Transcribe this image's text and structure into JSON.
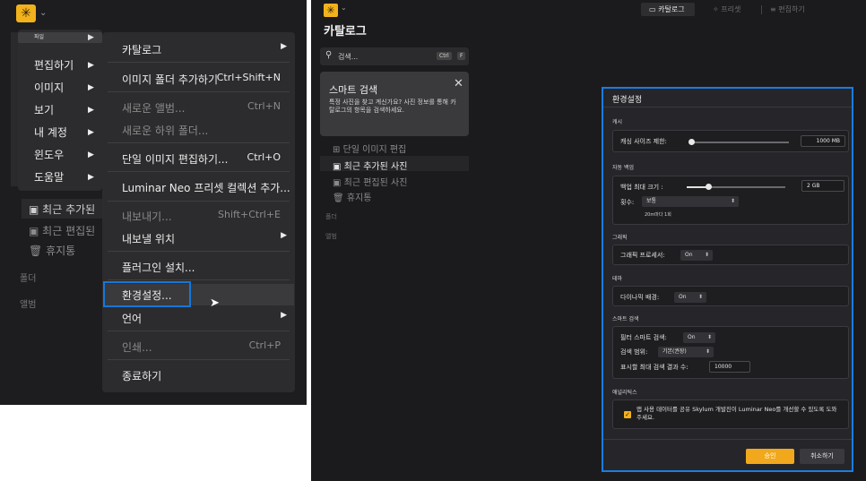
{
  "left": {
    "menu_main": [
      {
        "label": "파일",
        "selected": true
      },
      {
        "label": "편집하기"
      },
      {
        "label": "이미지"
      },
      {
        "label": "보기"
      },
      {
        "label": "내 계정"
      },
      {
        "label": "윈도우"
      },
      {
        "label": "도움말"
      }
    ],
    "menu_file": [
      {
        "label": "카탈로그",
        "shortcut": "",
        "submenu": true,
        "disabled": false
      },
      {
        "label": "이미지 폴더 추가하기",
        "shortcut": "Ctrl+Shift+N",
        "submenu": false,
        "disabled": false
      },
      {
        "label": "새로운 앨범...",
        "shortcut": "Ctrl+N",
        "submenu": false,
        "disabled": true
      },
      {
        "label": "새로운 하위 폴더...",
        "shortcut": "",
        "submenu": false,
        "disabled": true
      },
      {
        "label": "단일 이미지 편집하기...",
        "shortcut": "Ctrl+O",
        "submenu": false,
        "disabled": false
      },
      {
        "label": "Luminar Neo 프리셋 컬렉션 추가...",
        "shortcut": "",
        "submenu": false,
        "disabled": false
      },
      {
        "label": "내보내기...",
        "shortcut": "Shift+Ctrl+E",
        "submenu": false,
        "disabled": true
      },
      {
        "label": "내보낼 위치",
        "shortcut": "",
        "submenu": true,
        "disabled": false
      },
      {
        "label": "플러그인 설치...",
        "shortcut": "",
        "submenu": false,
        "disabled": false
      },
      {
        "label": "환경설정...",
        "shortcut": "",
        "submenu": false,
        "disabled": false
      },
      {
        "label": "언어",
        "shortcut": "",
        "submenu": true,
        "disabled": false
      },
      {
        "label": "인쇄...",
        "shortcut": "Ctrl+P",
        "submenu": false,
        "disabled": true
      },
      {
        "label": "종료하기",
        "shortcut": "",
        "submenu": false,
        "disabled": false
      }
    ],
    "sidebar": {
      "recent_added": "최근 추가된",
      "recent_edited": "최근 편집된",
      "trash": "휴지통",
      "folders": "폴더",
      "albums": "앨범"
    }
  },
  "right": {
    "toolbar": {
      "catalog": "카탈로그",
      "presets": "프리셋",
      "edit": "편집하기"
    },
    "title": "카탈로그",
    "search": {
      "placeholder": "검색...",
      "kbd1": "Ctrl",
      "kbd2": "F"
    },
    "smart_search": {
      "title": "스마트 검색",
      "desc": "특정 사진을 찾고 계신가요? 사진 정보를 통해 카탈로그의 항목을 검색하세요."
    },
    "nav": {
      "single_edit": "단일 이미지 편집",
      "recent_added": "최근 추가된 사진",
      "recent_edited": "최근 편집된 사진",
      "trash": "휴지통",
      "folders": "폴더",
      "albums": "앨범"
    },
    "dialog": {
      "title": "환경설정",
      "cache": {
        "heading": "캐시",
        "label": "캐싱 사이즈 제한:",
        "value": "1000 MB"
      },
      "backup": {
        "heading": "자동 백업",
        "size_label": "백업 최대 크기 :",
        "size_value": "2 GB",
        "count_label": "횟수:",
        "count_value": "보통",
        "note": "20m마다 1회"
      },
      "graphics": {
        "heading": "그래픽",
        "label": "그래픽 프로세서:",
        "value": "On"
      },
      "theme": {
        "heading": "테마",
        "label": "다이나믹 배경:",
        "value": "On"
      },
      "smart": {
        "heading": "스마트 검색",
        "filter_label": "필터 스마트 검색:",
        "filter_value": "On",
        "range_label": "검색 범위:",
        "range_value": "기본(권장)",
        "max_label": "표시할 최대 검색 결과 수:",
        "max_value": "10000"
      },
      "analytics": {
        "heading": "애널리틱스",
        "text": "앱 사용 데이터를 공유 Skylum 개발진이 Luminar Neo를 개선할 수 있도록 도와 주세요.",
        "checked": true
      },
      "ok": "승인",
      "cancel": "취소하기"
    }
  },
  "colors": {
    "accent": "#f2b21c",
    "highlight": "#1677d9"
  }
}
